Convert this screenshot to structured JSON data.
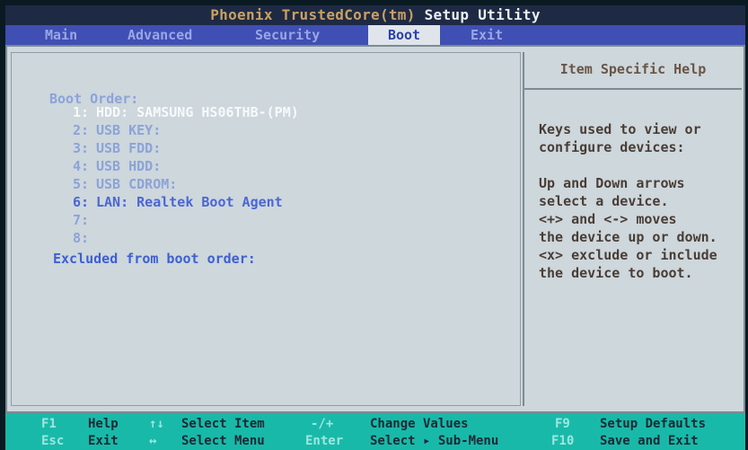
{
  "title": {
    "part1": "Phoenix TrustedCore(tm)",
    "part2": "Setup Utility"
  },
  "menu": [
    {
      "label": "Main"
    },
    {
      "label": "Advanced"
    },
    {
      "label": "Security"
    },
    {
      "label": "Boot"
    },
    {
      "label": "Exit"
    }
  ],
  "boot": {
    "label": "Boot Order:",
    "entries": [
      {
        "num": "1:",
        "text": "HDD: SAMSUNG HS06THB-(PM)"
      },
      {
        "num": "2:",
        "text": "USB KEY:"
      },
      {
        "num": "3:",
        "text": "USB FDD:"
      },
      {
        "num": "4:",
        "text": "USB HDD:"
      },
      {
        "num": "5:",
        "text": "USB CDROM:"
      },
      {
        "num": "6:",
        "text": "LAN: Realtek Boot Agent"
      },
      {
        "num": "7:",
        "text": ""
      },
      {
        "num": "8:",
        "text": ""
      }
    ],
    "excluded_label": "Excluded from boot order:"
  },
  "help": {
    "title": "Item Specific Help",
    "lines": [
      "Keys used to view or",
      "configure devices:",
      "Up and Down arrows",
      "select a device.",
      "<+> and <-> moves",
      "the device up or down.",
      "<x> exclude or include",
      "the device to boot."
    ]
  },
  "footer": {
    "keys": [
      {
        "key": "F1",
        "text": "Help"
      },
      {
        "key": "↑↓",
        "text": "Select Item"
      },
      {
        "key": "-/+",
        "text": "Change Values"
      },
      {
        "key": "F9",
        "text": "Setup Defaults"
      },
      {
        "key": "Esc",
        "text": "Exit"
      },
      {
        "key": "↔",
        "text": "Select Menu"
      },
      {
        "key": "Enter",
        "text": "Select ▸ Sub-Menu"
      },
      {
        "key": "F10",
        "text": "Save and Exit"
      }
    ]
  }
}
